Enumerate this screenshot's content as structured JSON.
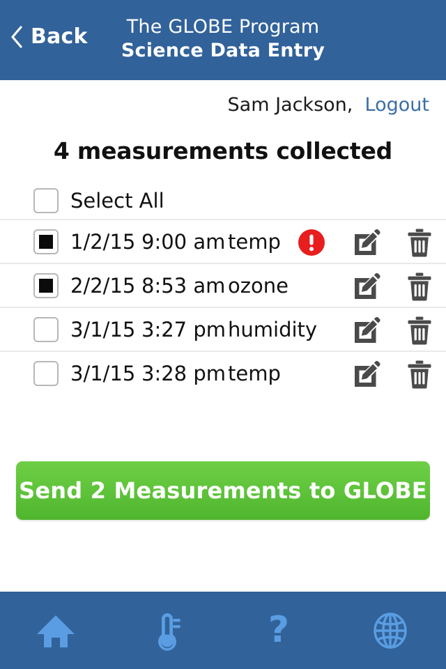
{
  "header": {
    "back_label": "Back",
    "back_icon": "chevron-left-icon",
    "title_top": "The GLOBE Program",
    "title_bottom": "Science Data Entry",
    "bg_color": "#31629a"
  },
  "account": {
    "user_name": "Sam Jackson,",
    "logout_label": "Logout",
    "logout_color": "#3b6ea5"
  },
  "main": {
    "count_heading": "4 measurements collected",
    "select_all_label": "Select All",
    "select_all_checked": false,
    "columns": [
      "date",
      "time",
      "type"
    ],
    "rows": [
      {
        "checked": true,
        "date": "1/2/15",
        "time": "9:00 am",
        "type": "temp",
        "alert": true,
        "alert_icon": "alert-circle-icon",
        "edit_icon": "edit-pencil-icon",
        "delete_icon": "trash-icon"
      },
      {
        "checked": true,
        "date": "2/2/15",
        "time": "8:53 am",
        "type": "ozone",
        "alert": false,
        "alert_icon": "",
        "edit_icon": "edit-pencil-icon",
        "delete_icon": "trash-icon"
      },
      {
        "checked": false,
        "date": "3/1/15",
        "time": "3:27 pm",
        "type": "humidity",
        "alert": false,
        "alert_icon": "",
        "edit_icon": "edit-pencil-icon",
        "delete_icon": "trash-icon"
      },
      {
        "checked": false,
        "date": "3/1/15",
        "time": "3:28 pm",
        "type": "temp",
        "alert": false,
        "alert_icon": "",
        "edit_icon": "edit-pencil-icon",
        "delete_icon": "trash-icon"
      }
    ],
    "send_button_label": "Send 2 Measurements to GLOBE",
    "send_button_color": "#5ec33a",
    "alert_color": "#e81e1e"
  },
  "bottom_nav": {
    "icon_color": "#5a9de2",
    "bg_color": "#31629a",
    "items": [
      {
        "icon": "home-icon",
        "name": "nav-home"
      },
      {
        "icon": "thermometer-icon",
        "name": "nav-thermometer"
      },
      {
        "icon": "question-icon",
        "name": "nav-help"
      },
      {
        "icon": "globe-icon",
        "name": "nav-globe"
      }
    ]
  }
}
